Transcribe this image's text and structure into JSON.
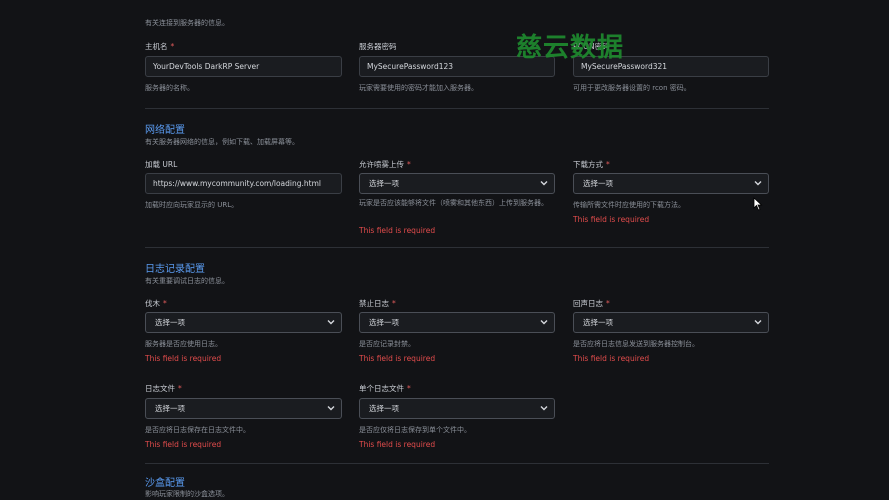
{
  "server_section": {
    "desc": "有关连接到服务器的信息。",
    "fields": {
      "hostname": {
        "label": "主机名",
        "value": "YourDevTools DarkRP Server",
        "help": "服务器的名称。"
      },
      "server_password": {
        "label": "服务器密码",
        "value": "MySecurePassword123",
        "help": "玩家需要使用的密码才能加入服务器。"
      },
      "rcon_password": {
        "label": "RCON密码",
        "value": "MySecurePassword321",
        "help": "可用于更改服务器设置的 rcon 密码。"
      }
    }
  },
  "network_section": {
    "title": "网络配置",
    "desc": "有关服务器网络的信息，例如下载、加载屏幕等。",
    "fields": {
      "loading_url": {
        "label": "加载 URL",
        "value": "https://www.mycommunity.com/loading.html",
        "help": "加载时应向玩家显示的 URL。"
      },
      "allow_upload": {
        "label": "允许喷雾上传",
        "value": "选择一项",
        "help": "玩家是否应该能够将文件（喷雾和其他东西）上传到服务器。",
        "error": "This field is required"
      },
      "download_mode": {
        "label": "下载方式",
        "value": "选择一项",
        "help": "传输所需文件时应使用的下载方法。",
        "error": "This field is required"
      }
    }
  },
  "logging_section": {
    "title": "日志记录配置",
    "desc": "有关重要调试日志的信息。",
    "fields": {
      "logging": {
        "label": "伐木",
        "value": "选择一项",
        "help": "服务器是否应使用日志。",
        "error": "This field is required"
      },
      "ban_log": {
        "label": "禁止日志",
        "value": "选择一项",
        "help": "是否应记录封禁。",
        "error": "This field is required"
      },
      "echo_log": {
        "label": "回声日志",
        "value": "选择一项",
        "help": "是否应将日志信息发送到服务器控制台。",
        "error": "This field is required"
      },
      "log_file": {
        "label": "日志文件",
        "value": "选择一项",
        "help": "是否应将日志保存在日志文件中。",
        "error": "This field is required"
      },
      "single_log": {
        "label": "单个日志文件",
        "value": "选择一项",
        "help": "是否应仅将日志保存到单个文件中。",
        "error": "This field is required"
      }
    }
  },
  "sandbox_section": {
    "title": "沙盒配置",
    "desc": "影响玩家限制的沙盒选项。"
  },
  "required_mark": "*",
  "watermark": "慈云数据",
  "colors": {
    "accent": "#5b9cf2",
    "error": "#e24c4c",
    "background": "#121316"
  }
}
